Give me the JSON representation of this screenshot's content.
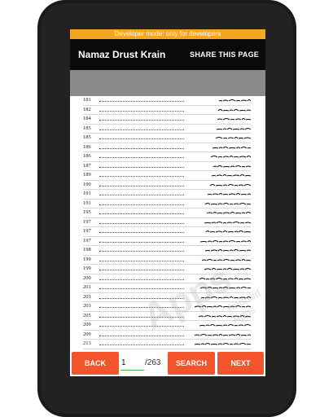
{
  "status_banner": "Developer mode: only for developers",
  "header": {
    "title": "Namaz Drust Krain",
    "share_label": "SHARE THIS PAGE"
  },
  "toc": {
    "page_numbers": [
      "181",
      "182",
      "184",
      "185",
      "185",
      "186",
      "186",
      "187",
      "189",
      "190",
      "191",
      "191",
      "195",
      "197",
      "197",
      "197",
      "198",
      "199",
      "199",
      "200",
      "201",
      "203",
      "203",
      "205",
      "209",
      "209",
      "213",
      "217"
    ]
  },
  "watermark": {
    "main": "Apps",
    "sub": "Android Apps"
  },
  "footer": {
    "back_label": "BACK",
    "page_value": "1",
    "total_pages": "/263",
    "search_label": "SEARCH",
    "next_label": "NEXT"
  },
  "colors": {
    "banner": "#f4a623",
    "appbar": "#0a0a0a",
    "button": "#f2552c",
    "input_underline": "#4caf50"
  }
}
